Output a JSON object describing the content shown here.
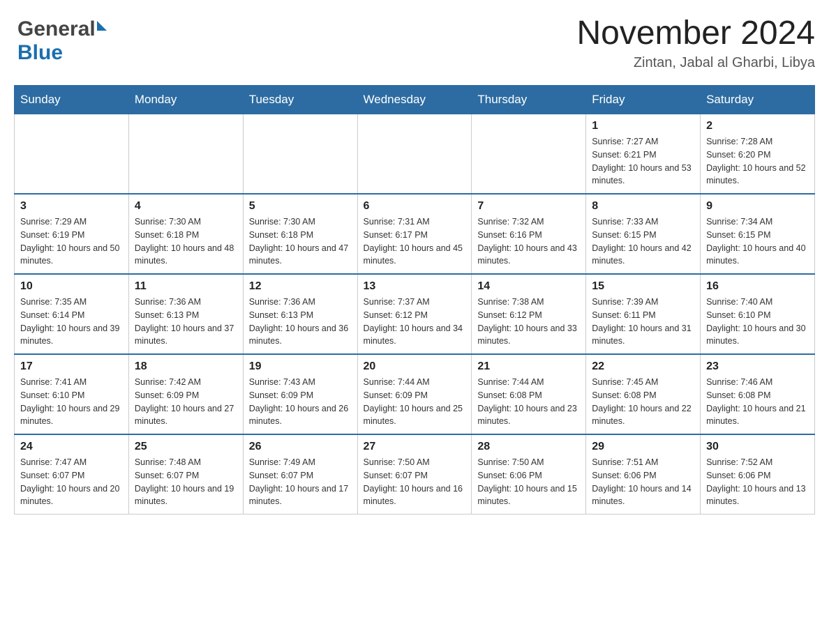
{
  "header": {
    "logo_general": "General",
    "logo_blue": "Blue",
    "month_title": "November 2024",
    "location": "Zintan, Jabal al Gharbi, Libya"
  },
  "weekdays": [
    "Sunday",
    "Monday",
    "Tuesday",
    "Wednesday",
    "Thursday",
    "Friday",
    "Saturday"
  ],
  "weeks": [
    [
      {
        "day": "",
        "info": ""
      },
      {
        "day": "",
        "info": ""
      },
      {
        "day": "",
        "info": ""
      },
      {
        "day": "",
        "info": ""
      },
      {
        "day": "",
        "info": ""
      },
      {
        "day": "1",
        "info": "Sunrise: 7:27 AM\nSunset: 6:21 PM\nDaylight: 10 hours and 53 minutes."
      },
      {
        "day": "2",
        "info": "Sunrise: 7:28 AM\nSunset: 6:20 PM\nDaylight: 10 hours and 52 minutes."
      }
    ],
    [
      {
        "day": "3",
        "info": "Sunrise: 7:29 AM\nSunset: 6:19 PM\nDaylight: 10 hours and 50 minutes."
      },
      {
        "day": "4",
        "info": "Sunrise: 7:30 AM\nSunset: 6:18 PM\nDaylight: 10 hours and 48 minutes."
      },
      {
        "day": "5",
        "info": "Sunrise: 7:30 AM\nSunset: 6:18 PM\nDaylight: 10 hours and 47 minutes."
      },
      {
        "day": "6",
        "info": "Sunrise: 7:31 AM\nSunset: 6:17 PM\nDaylight: 10 hours and 45 minutes."
      },
      {
        "day": "7",
        "info": "Sunrise: 7:32 AM\nSunset: 6:16 PM\nDaylight: 10 hours and 43 minutes."
      },
      {
        "day": "8",
        "info": "Sunrise: 7:33 AM\nSunset: 6:15 PM\nDaylight: 10 hours and 42 minutes."
      },
      {
        "day": "9",
        "info": "Sunrise: 7:34 AM\nSunset: 6:15 PM\nDaylight: 10 hours and 40 minutes."
      }
    ],
    [
      {
        "day": "10",
        "info": "Sunrise: 7:35 AM\nSunset: 6:14 PM\nDaylight: 10 hours and 39 minutes."
      },
      {
        "day": "11",
        "info": "Sunrise: 7:36 AM\nSunset: 6:13 PM\nDaylight: 10 hours and 37 minutes."
      },
      {
        "day": "12",
        "info": "Sunrise: 7:36 AM\nSunset: 6:13 PM\nDaylight: 10 hours and 36 minutes."
      },
      {
        "day": "13",
        "info": "Sunrise: 7:37 AM\nSunset: 6:12 PM\nDaylight: 10 hours and 34 minutes."
      },
      {
        "day": "14",
        "info": "Sunrise: 7:38 AM\nSunset: 6:12 PM\nDaylight: 10 hours and 33 minutes."
      },
      {
        "day": "15",
        "info": "Sunrise: 7:39 AM\nSunset: 6:11 PM\nDaylight: 10 hours and 31 minutes."
      },
      {
        "day": "16",
        "info": "Sunrise: 7:40 AM\nSunset: 6:10 PM\nDaylight: 10 hours and 30 minutes."
      }
    ],
    [
      {
        "day": "17",
        "info": "Sunrise: 7:41 AM\nSunset: 6:10 PM\nDaylight: 10 hours and 29 minutes."
      },
      {
        "day": "18",
        "info": "Sunrise: 7:42 AM\nSunset: 6:09 PM\nDaylight: 10 hours and 27 minutes."
      },
      {
        "day": "19",
        "info": "Sunrise: 7:43 AM\nSunset: 6:09 PM\nDaylight: 10 hours and 26 minutes."
      },
      {
        "day": "20",
        "info": "Sunrise: 7:44 AM\nSunset: 6:09 PM\nDaylight: 10 hours and 25 minutes."
      },
      {
        "day": "21",
        "info": "Sunrise: 7:44 AM\nSunset: 6:08 PM\nDaylight: 10 hours and 23 minutes."
      },
      {
        "day": "22",
        "info": "Sunrise: 7:45 AM\nSunset: 6:08 PM\nDaylight: 10 hours and 22 minutes."
      },
      {
        "day": "23",
        "info": "Sunrise: 7:46 AM\nSunset: 6:08 PM\nDaylight: 10 hours and 21 minutes."
      }
    ],
    [
      {
        "day": "24",
        "info": "Sunrise: 7:47 AM\nSunset: 6:07 PM\nDaylight: 10 hours and 20 minutes."
      },
      {
        "day": "25",
        "info": "Sunrise: 7:48 AM\nSunset: 6:07 PM\nDaylight: 10 hours and 19 minutes."
      },
      {
        "day": "26",
        "info": "Sunrise: 7:49 AM\nSunset: 6:07 PM\nDaylight: 10 hours and 17 minutes."
      },
      {
        "day": "27",
        "info": "Sunrise: 7:50 AM\nSunset: 6:07 PM\nDaylight: 10 hours and 16 minutes."
      },
      {
        "day": "28",
        "info": "Sunrise: 7:50 AM\nSunset: 6:06 PM\nDaylight: 10 hours and 15 minutes."
      },
      {
        "day": "29",
        "info": "Sunrise: 7:51 AM\nSunset: 6:06 PM\nDaylight: 10 hours and 14 minutes."
      },
      {
        "day": "30",
        "info": "Sunrise: 7:52 AM\nSunset: 6:06 PM\nDaylight: 10 hours and 13 minutes."
      }
    ]
  ]
}
